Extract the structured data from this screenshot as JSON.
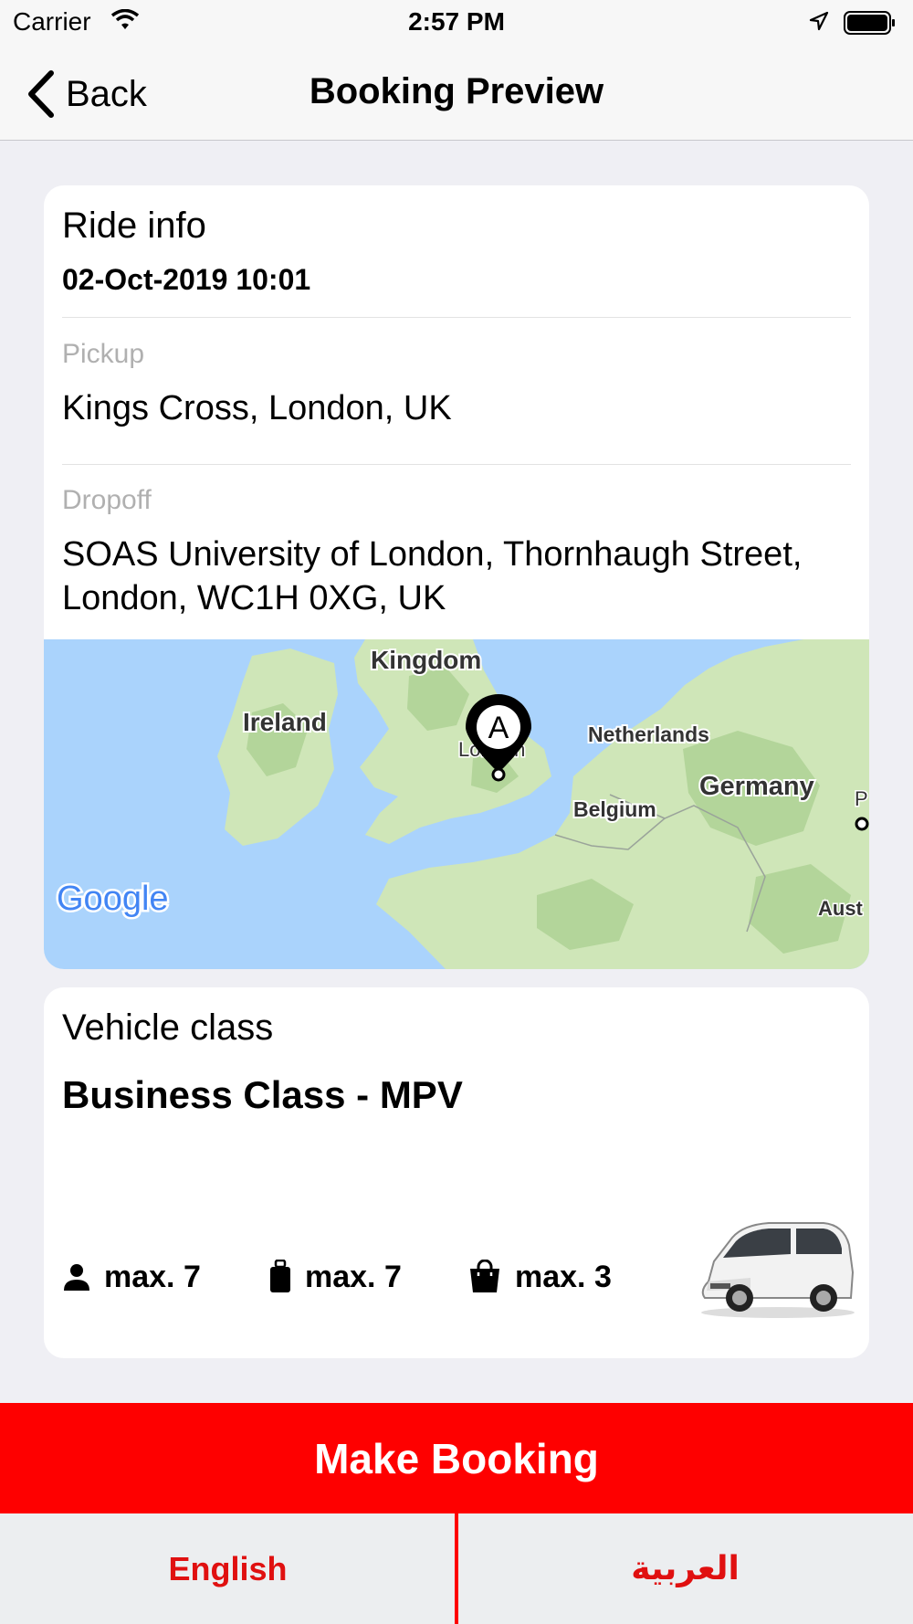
{
  "status_bar": {
    "carrier": "Carrier",
    "time": "2:57 PM"
  },
  "nav": {
    "back_label": "Back",
    "title": "Booking Preview"
  },
  "ride": {
    "heading": "Ride info",
    "datetime": "02-Oct-2019 10:01",
    "pickup_label": "Pickup",
    "pickup_value": "Kings Cross, London, UK",
    "dropoff_label": "Dropoff",
    "dropoff_value": "SOAS University of London, Thornhaugh Street, London,  WC1H 0XG, UK"
  },
  "map": {
    "labels": {
      "kingdom": "Kingdom",
      "ireland": "Ireland",
      "london": "London",
      "netherlands": "Netherlands",
      "germany": "Germany",
      "belgium": "Belgium",
      "p": "P",
      "aust": "Aust"
    },
    "marker_letter": "A",
    "logo": "Google",
    "colors": {
      "water": "#aad3fc",
      "land": "#cfe6b8",
      "forest": "#b3d59a"
    }
  },
  "vehicle": {
    "heading": "Vehicle class",
    "name": "Business Class - MPV",
    "passengers": "max. 7",
    "luggage": "max. 7",
    "bags": "max. 3"
  },
  "actions": {
    "make_booking": "Make Booking"
  },
  "language": {
    "english": "English",
    "arabic": "العربية"
  },
  "colors": {
    "accent": "#fe0000",
    "language_text": "#e01010"
  }
}
